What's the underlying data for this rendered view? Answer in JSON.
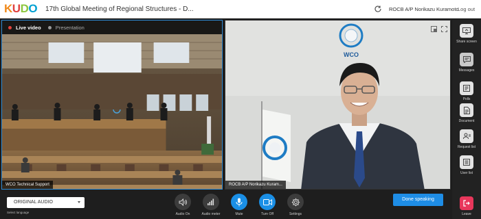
{
  "app": {
    "logo": [
      "K",
      "U",
      "D",
      "O"
    ],
    "meeting_title": "17th Global Meeting of Regional Structures - D...",
    "user_name": "ROCB A/P Norikazu Kuramoto",
    "logout_label": "Log out"
  },
  "video_tabs": {
    "live_label": "Live video",
    "presentation_label": "Presentation"
  },
  "left_video": {
    "speaker_label": "WCO Technical Support"
  },
  "right_video": {
    "speaker_label": "ROCB A/P Norikazu Kuram...",
    "logo_text": "WCO"
  },
  "side_panel": [
    {
      "label": "Share screen",
      "icon": "share-screen-icon"
    },
    {
      "label": "Messages",
      "icon": "messages-icon"
    },
    {
      "label": "Polls",
      "icon": "polls-icon"
    },
    {
      "label": "Document",
      "icon": "document-icon"
    },
    {
      "label": "Request list",
      "icon": "request-list-icon"
    },
    {
      "label": "User list",
      "icon": "user-list-icon"
    },
    {
      "label": "Leave",
      "icon": "leave-icon"
    }
  ],
  "bottom_bar": {
    "audio_select_value": "ORIGINAL AUDIO",
    "select_language_label": "Select language",
    "controls": [
      {
        "label": "Audio On",
        "icon": "speaker-icon"
      },
      {
        "label": "Audio meter",
        "icon": "audio-meter-icon"
      },
      {
        "label": "Mute",
        "icon": "microphone-icon"
      },
      {
        "label": "Turn Off",
        "icon": "video-camera-icon"
      },
      {
        "label": "Settings",
        "icon": "gear-icon"
      }
    ],
    "done_speaking_label": "Done speaking"
  },
  "colors": {
    "accent_blue": "#1e8de6",
    "live_dot": "#e2433d",
    "leave_red": "#e8375b",
    "panel_dark": "#1e1e1e"
  }
}
